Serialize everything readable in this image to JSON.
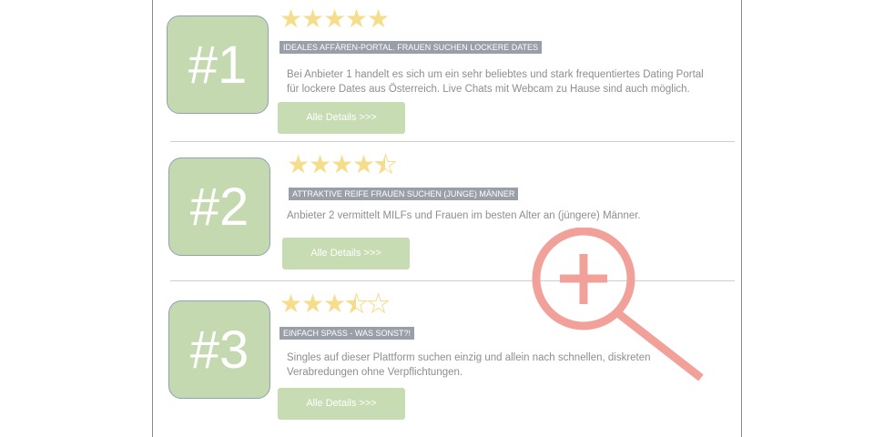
{
  "listings": [
    {
      "rank": "#1",
      "rating": 5,
      "rating_max": 5,
      "tag": "IDEALES AFFÄREN-PORTAL. FRAUEN SUCHEN LOCKERE DATES",
      "desc_line1": "Bei Anbieter 1 handelt es sich um ein sehr beliebtes und stark frequentiertes Dating Portal",
      "desc_line2": "für lockere Dates aus Österreich. Live Chats mit Webcam zu Hause sind auch möglich.",
      "button": "Alle Details >>>"
    },
    {
      "rank": "#2",
      "rating": 4.5,
      "rating_max": 5,
      "tag": "ATTRAKTIVE REIFE FRAUEN SUCHEN (JUNGE) MÄNNER",
      "desc_line1": "Anbieter 2 vermittelt MILFs und Frauen im besten Alter an (jüngere) Männer.",
      "desc_line2": "",
      "button": "Alle Details >>>"
    },
    {
      "rank": "#3",
      "rating": 3.5,
      "rating_max": 5,
      "tag": "EINFACH SPASS - WAS SONST?!",
      "desc_line1": "Singles auf dieser Plattform suchen einzig und allein nach schnellen, diskreten",
      "desc_line2": "Verabredungen ohne Verpflichtungen.",
      "button": "Alle Details >>>"
    }
  ],
  "icons": {
    "zoom": "zoom-in-icon"
  },
  "colors": {
    "rank_bg": "#c5d9b0",
    "star": "#f5dd8c",
    "tag_bg": "#9a9ea8",
    "button_bg": "#c8dcb4",
    "zoom": "#f2a19a"
  }
}
